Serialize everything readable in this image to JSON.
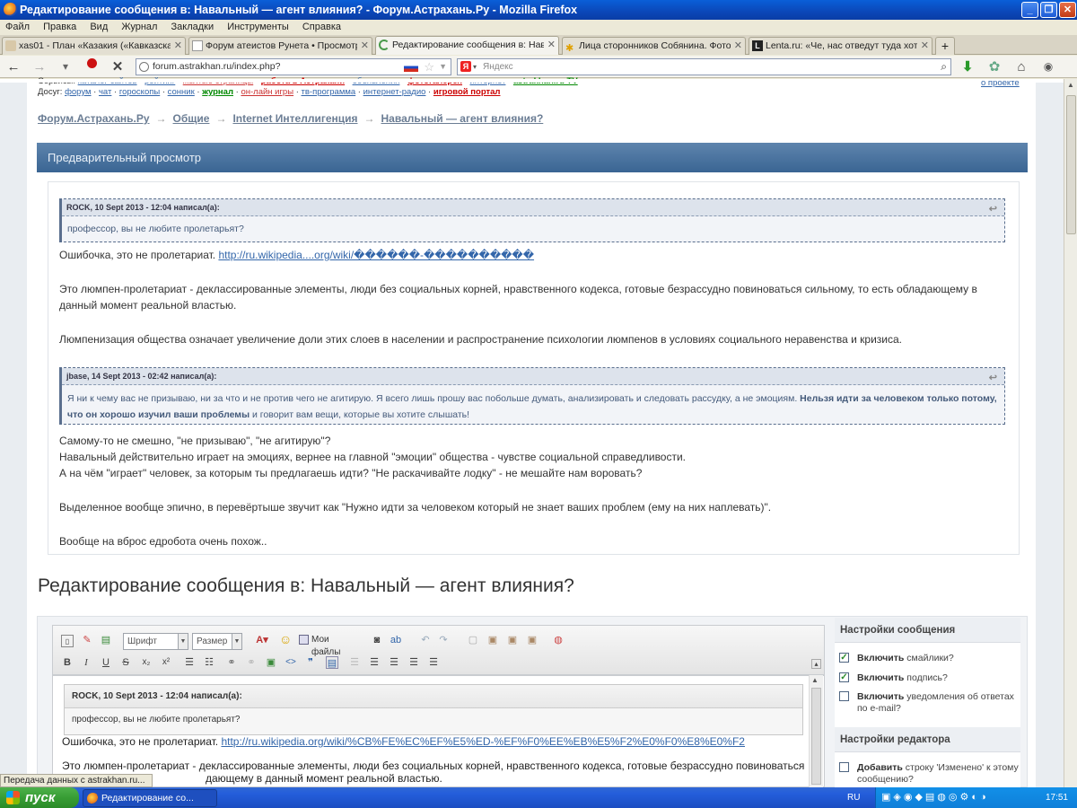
{
  "window": {
    "title": "Редактирование сообщения в: Навальный — агент влияния? - Форум.Астрахань.Ру - Mozilla Firefox",
    "controls": [
      "_",
      "❐",
      "✕"
    ]
  },
  "menu": [
    "Файл",
    "Правка",
    "Вид",
    "Журнал",
    "Закладки",
    "Инструменты",
    "Справка"
  ],
  "tabs": [
    {
      "label": "xas01 - План «Казакия («Кавказская Р...",
      "active": false
    },
    {
      "label": "Форум атеистов Рунета • Просмотр те...",
      "active": false
    },
    {
      "label": "Редактирование сообщения в: Навал...",
      "active": true
    },
    {
      "label": "Лица сторонников Собянина. Фотореп...",
      "active": false
    },
    {
      "label": "Lenta.ru: «Че, нас отведут туда хотя ...",
      "active": false
    }
  ],
  "nav": {
    "url": "forum.astrakhan.ru/index.php?",
    "search_placeholder": "Яндекс"
  },
  "top_services": {
    "services_label": "Сервисы:",
    "services_links": [
      "каталог сайтов",
      "рейтинг",
      "желтые страницы",
      "работа в Астрахани",
      "объявления",
      "фотогалерея",
      "интернет",
      "astrakhan.ru TV"
    ],
    "leisure_label": "Досуг:",
    "leisure_links": [
      "форум",
      "чат",
      "гороскопы",
      "сонник",
      "журнал",
      "он-лайн игры",
      "тв-программа",
      "интернет-радио",
      "игровой портал"
    ],
    "about_link": "о проекте"
  },
  "breadcrumb": [
    "Форум.Астрахань.Ру",
    "Общие",
    "Internet Интеллигенция",
    "Навальный — агент влияния?"
  ],
  "breadcrumb_sep": "→",
  "preview": {
    "header": "Предварительный просмотр",
    "quote1": {
      "author": "ROCK, 10 Sept 2013 - 12:04 написал(а):",
      "text": "профессор, вы не любите пролетарьят?"
    },
    "p1_prefix": "Ошибочка, это не пролетариат. ",
    "p1_link": "http://ru.wikipedia....org/wiki/������-����������",
    "p2": "Это люмпен-пролетариат - деклассированные элементы, люди без социальных корней, нравственного кодекса, готовые безрассудно повиноваться сильному, то есть обладающему в данный момент реальной властью.",
    "p3": "Люмпенизация общества означает увеличение доли этих слоев в населении и распространение психологии люмпенов в условиях социального неравенства и кризиса.",
    "quote2": {
      "author": "jbase, 14 Sept 2013 - 02:42 написал(а):",
      "text_before": "Я ни к чему вас не призываю, ни за что и не против чего не агитирую. Я всего лишь прошу вас побольше думать, анализировать и следовать рассудку, а не эмоциям. ",
      "text_bold": "Нельзя идти за человеком только потому, что он хорошо изучил ваши проблемы",
      "text_after": " и  говорит вам вещи, которые вы хотите слышать!"
    },
    "p4": "Самому-то не смешно, \"не призываю\", \"не агитирую\"?",
    "p5": "Навальный действительно играет на эмоциях, вернее на главной \"эмоции\" общества - чувстве социальной справедливости.",
    "p6": "А на чём \"играет\" человек, за которым ты предлагаешь идти? \"Не раскачивайте лодку\" - не мешайте нам воровать?",
    "p7": "Выделенное вообще эпично, в перевёртыше звучит как \"Нужно идти за человеком который не знает ваших проблем (ему на них наплевать)\".",
    "p8": "Вообще на вброс едробота очень похож.."
  },
  "edit": {
    "title": "Редактирование сообщения в: Навальный — агент влияния?",
    "font_select": "Шрифт",
    "size_select": "Размер",
    "my_files": "Мои файлы",
    "quote_author": "ROCK, 10 Sept 2013 - 12:04 написал(а):",
    "quote_text": "профессор, вы не любите пролетарьят?",
    "line1_prefix": "Ошибочка, это не пролетариат. ",
    "line1_link": "http://ru.wikipedia.org/wiki/%CB%FE%EC%EF%E5%ED-%EF%F0%EE%EB%E5%F2%E0%F0%E8%E0%F2",
    "line2": "Это люмпен-пролетариат - деклассированные элементы, люди без социальных корней, нравственного кодекса, готовые безрассудно повиноваться",
    "line3": "дающему в данный момент реальной властью."
  },
  "settings": {
    "msg_header": "Настройки сообщения",
    "opt1_bold": "Включить",
    "opt1_rest": " смайлики?",
    "opt2_bold": "Включить",
    "opt2_rest": " подпись?",
    "opt3_bold": "Включить",
    "opt3_rest": " уведомления об ответах по e-mail?",
    "editor_header": "Настройки редактора",
    "opt4_bold": "Добавить",
    "opt4_rest": " строку 'Изменено' к этому сообщению?"
  },
  "status_text": "Передача данных с astrakhan.ru...",
  "taskbar": {
    "start": "пуск",
    "task": "Редактирование со...",
    "lang": "RU",
    "clock": "17:51"
  }
}
